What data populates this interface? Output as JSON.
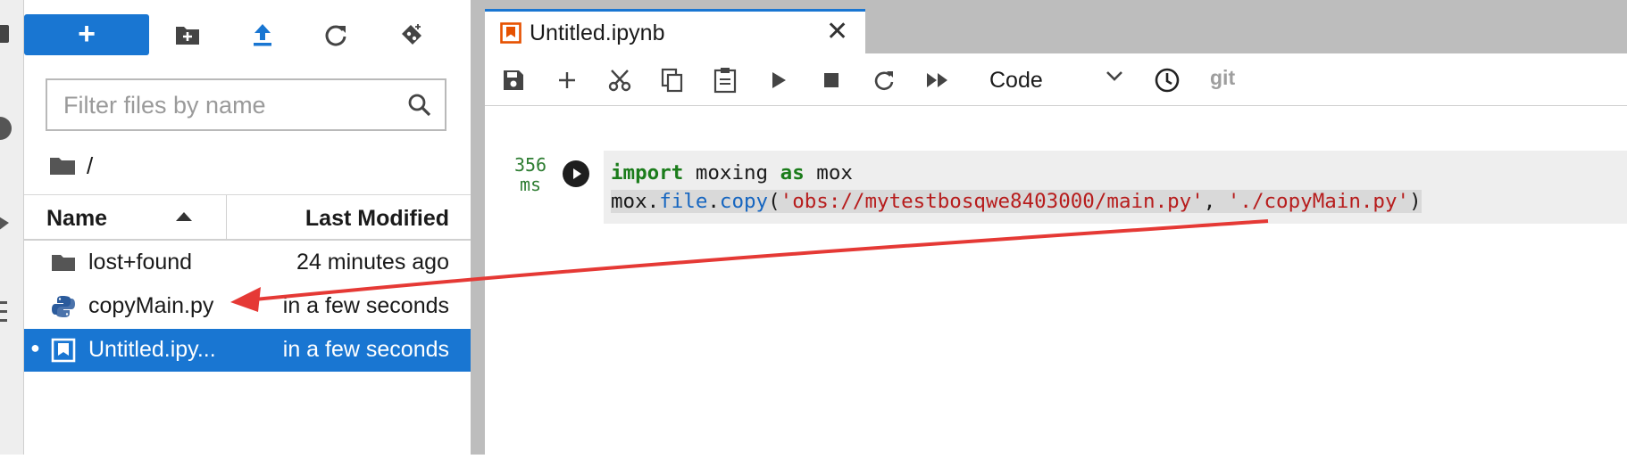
{
  "filebrowser": {
    "new_launcher_label": "+",
    "filter_placeholder": "Filter files by name",
    "breadcrumb_path": "/",
    "columns": {
      "name": "Name",
      "modified": "Last Modified"
    },
    "files": [
      {
        "name": "lost+found",
        "modified": "24 minutes ago",
        "type": "folder"
      },
      {
        "name": "copyMain.py",
        "modified": "in a few seconds",
        "type": "python"
      },
      {
        "name": "Untitled.ipy...",
        "modified": "in a few seconds",
        "type": "notebook",
        "selected": true,
        "running_dot": "●"
      }
    ]
  },
  "tab": {
    "title": "Untitled.ipynb",
    "close": "✕"
  },
  "toolbar": {
    "cell_type": "Code",
    "git": "git"
  },
  "cell": {
    "exec_time": "356",
    "exec_unit": "ms",
    "code": {
      "line1_kw1": "import",
      "line1_mod": " moxing ",
      "line1_kw2": "as",
      "line1_alias": " mox",
      "line2_obj": "mox.",
      "line2_attr1": "file",
      "line2_dot": ".",
      "line2_attr2": "copy",
      "line2_open": "(",
      "line2_src": "'obs://mytestbosqwe8403000/main.py'",
      "line2_comma": ", ",
      "line2_dst": "'./copyMain.py'",
      "line2_close": ")"
    }
  },
  "colors": {
    "accent": "#1976d2",
    "arrow": "#e53935",
    "keyword": "#1b7c1b",
    "string": "#b71c1c"
  }
}
